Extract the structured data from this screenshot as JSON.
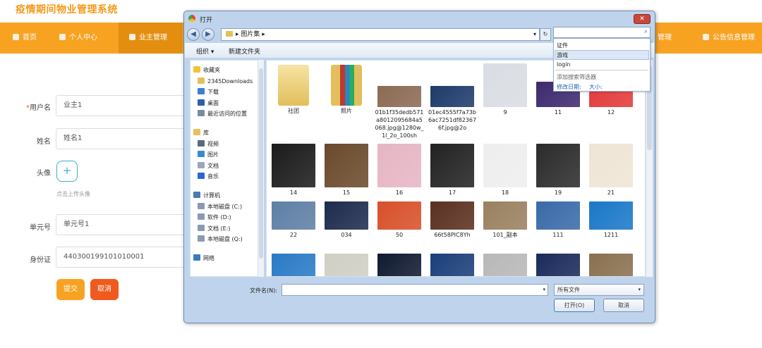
{
  "app": {
    "title": "疫情期间物业管理系统"
  },
  "nav": [
    {
      "label": "首页"
    },
    {
      "label": "个人中心"
    },
    {
      "label": "业主管理"
    },
    {
      "label": "管理"
    },
    {
      "label": "公告信息管理"
    }
  ],
  "form": {
    "username_label": "用户名",
    "required_mark": "*",
    "username_value": "业主1",
    "name_label": "姓名",
    "name_value": "姓名1",
    "avatar_label": "头像",
    "avatar_plus": "+",
    "avatar_hint": "点击上传头像",
    "unit_label": "单元号",
    "unit_value": "单元号1",
    "id_label": "身份证",
    "id_value": "440300199101010001",
    "submit": "提交",
    "cancel": "取消"
  },
  "dialog": {
    "title": "打开",
    "close": "✕",
    "back": "◀",
    "forward": "▶",
    "address_sep1": "▸",
    "address": "图片集",
    "address_sep2": "▸",
    "address_dropdown": "▾",
    "refresh": "↻",
    "search_value": "",
    "organize": "组织 ▾",
    "new_folder": "新建文件夹",
    "sidebar": [
      {
        "label": "收藏夹",
        "type": "header",
        "icon": "star-icon"
      },
      {
        "label": "2345Downloads",
        "type": "item",
        "icon": "folder-icon"
      },
      {
        "label": "下载",
        "type": "item",
        "icon": "download-icon"
      },
      {
        "label": "桌面",
        "type": "item",
        "icon": "desktop-icon"
      },
      {
        "label": "最近访问的位置",
        "type": "item",
        "icon": "recent-icon"
      },
      {
        "label": "库",
        "type": "header",
        "icon": "library-icon"
      },
      {
        "label": "视频",
        "type": "item",
        "icon": "video-icon"
      },
      {
        "label": "图片",
        "type": "item",
        "icon": "picture-icon"
      },
      {
        "label": "文档",
        "type": "item",
        "icon": "document-icon"
      },
      {
        "label": "音乐",
        "type": "item",
        "icon": "music-icon"
      },
      {
        "label": "计算机",
        "type": "header",
        "icon": "computer-icon"
      },
      {
        "label": "本地磁盘 (C:)",
        "type": "item",
        "icon": "disk-icon"
      },
      {
        "label": "软件 (D:)",
        "type": "item",
        "icon": "disk-icon"
      },
      {
        "label": "文档 (E:)",
        "type": "item",
        "icon": "disk-icon"
      },
      {
        "label": "本地磁盘 (Q:)",
        "type": "item",
        "icon": "disk-icon"
      },
      {
        "label": "网络",
        "type": "header",
        "icon": "network-icon"
      }
    ],
    "files": [
      {
        "name": "社团",
        "kind": "folder"
      },
      {
        "name": "照片",
        "kind": "folder-archive"
      },
      {
        "name": "01b1f35dedb571a8012095684a5068.jpg@1280w_1l_2o_100sh",
        "kind": "image",
        "color": "#8c6a54"
      },
      {
        "name": "01ec4555f7a73b6ac7251df823676f.jpg@2o",
        "kind": "image",
        "color": "#1d3b6a"
      },
      {
        "name": "9",
        "kind": "image",
        "color": "#d9dde3"
      },
      {
        "name": "11",
        "kind": "image",
        "color": "#3d2a6e"
      },
      {
        "name": "12",
        "kind": "image",
        "color": "#e23a3a"
      },
      {
        "name": "14",
        "kind": "image",
        "color": "#1b1b1b"
      },
      {
        "name": "15",
        "kind": "image",
        "color": "#6a4a2c"
      },
      {
        "name": "16",
        "kind": "image",
        "color": "#e6b5c4"
      },
      {
        "name": "17",
        "kind": "image",
        "color": "#222222"
      },
      {
        "name": "18",
        "kind": "image",
        "color": "#eeeeee"
      },
      {
        "name": "19",
        "kind": "image",
        "color": "#2b2b2b"
      },
      {
        "name": "21",
        "kind": "image",
        "color": "#efe5d6"
      },
      {
        "name": "22",
        "kind": "image",
        "color": "#5f7fa6"
      },
      {
        "name": "034",
        "kind": "image",
        "color": "#1d2b4d"
      },
      {
        "name": "50",
        "kind": "image",
        "color": "#d8502a"
      },
      {
        "name": "66t58PIC8Yh",
        "kind": "image",
        "color": "#5a3020"
      },
      {
        "name": "101_副本",
        "kind": "image",
        "color": "#9a8060"
      },
      {
        "name": "111",
        "kind": "image",
        "color": "#3a6aa8"
      },
      {
        "name": "1211",
        "kind": "image",
        "color": "#1a78c8"
      },
      {
        "name": "",
        "kind": "image",
        "color": "#2a7ac6"
      },
      {
        "name": "",
        "kind": "image",
        "color": "#cfcfc4"
      },
      {
        "name": "",
        "kind": "image",
        "color": "#101a30"
      },
      {
        "name": "",
        "kind": "image",
        "color": "#1b3e7a"
      },
      {
        "name": "",
        "kind": "image",
        "color": "#b8b8b8"
      },
      {
        "name": "",
        "kind": "image",
        "color": "#1a2a5a"
      },
      {
        "name": "",
        "kind": "image",
        "color": "#8a7050"
      }
    ],
    "filename_label": "文件名(N):",
    "filename_value": "",
    "filetype": "所有文件",
    "open": "打开(O)",
    "cancel": "取消",
    "search_suggest": {
      "items": [
        "证件",
        "游戏",
        "login"
      ],
      "add_filter": "添加搜索筛选器",
      "filter_date": "修改日期:",
      "filter_size": "大小:"
    }
  },
  "colors": {
    "accent": "#f8a222",
    "submit": "#f8a222",
    "cancel": "#f05a1e",
    "dialog_frame": "#bfd4ec"
  }
}
